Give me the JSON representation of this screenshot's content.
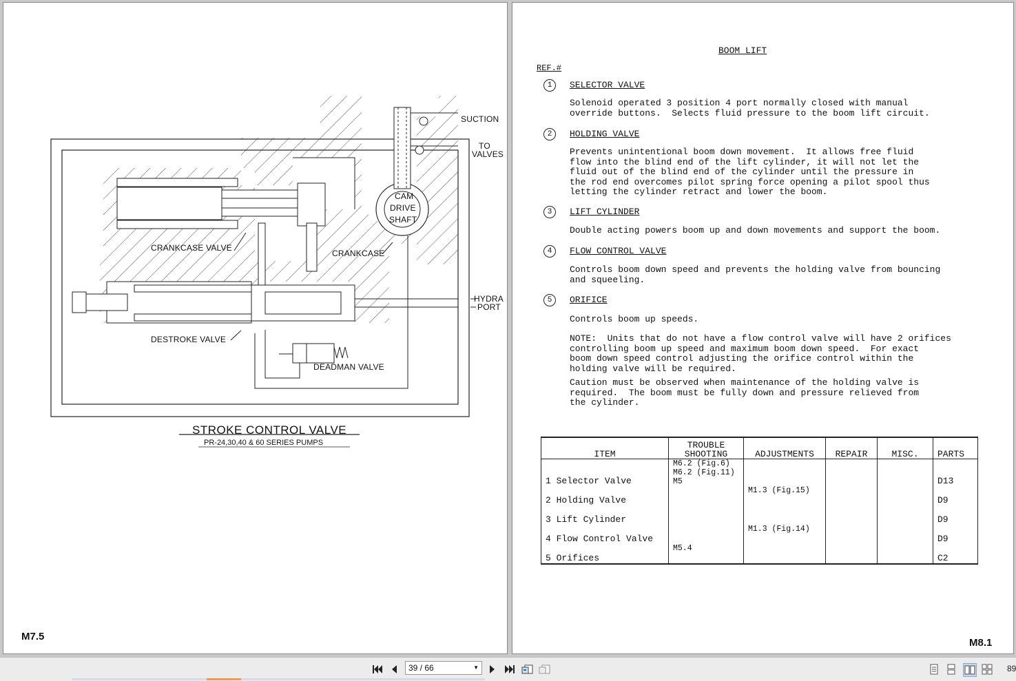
{
  "left_page": {
    "diagram_labels": {
      "suction": "SUCTION",
      "to_valves_1": "TO",
      "to_valves_2": "VALVES",
      "cam_1": "CAM",
      "cam_2": "DRIVE",
      "cam_3": "SHAFT",
      "crankcase_valve": "CRANKCASE VALVE",
      "crankcase": "CRANKCASE",
      "hydra_1": "HYDRA",
      "hydra_2": "PORT",
      "destroke_valve": "DESTROKE VALVE",
      "deadman_valve": "DEADMAN VALVE"
    },
    "title": "STROKE CONTROL VALVE",
    "subtitle": "PR-24,30,40 & 60 SERIES PUMPS",
    "page_number": "M7.5"
  },
  "right_page": {
    "heading": "BOOM LIFT",
    "ref_label": "REF.#",
    "sections": [
      {
        "num": "1",
        "title": "SELECTOR VALVE",
        "body": "Solenoid operated 3 position 4 port normally closed with manual\noverride buttons.  Selects fluid pressure to the boom lift circuit."
      },
      {
        "num": "2",
        "title": "HOLDING VALVE",
        "body": "Prevents unintentional boom down movement.  It allows free fluid\nflow into the blind end of the lift cylinder, it will not let the\nfluid out of the blind end of the cylinder until the pressure in\nthe rod end overcomes pilot spring force opening a pilot spool thus\nletting the cylinder retract and lower the boom."
      },
      {
        "num": "3",
        "title": "LIFT CYLINDER",
        "body": "Double acting powers boom up and down movements and support the boom."
      },
      {
        "num": "4",
        "title": "FLOW CONTROL VALVE",
        "body": "Controls boom down speed and prevents the holding valve from bouncing\nand squeeling."
      },
      {
        "num": "5",
        "title": "ORIFICE",
        "body": "Controls boom up speeds."
      }
    ],
    "note": "NOTE:  Units that do not have a flow control valve will have 2 orifices\ncontrolling boom up speed and maximum boom down speed.  For exact\nboom down speed control adjusting the orifice control within the\nholding valve will be required.",
    "caution": "Caution must be observed when maintenance of the holding valve is\nrequired.  The boom must be fully down and pressure relieved from\nthe cylinder.",
    "table": {
      "headers": {
        "item": "ITEM",
        "ts1": "TROUBLE",
        "ts2": "SHOOTING",
        "adjustments": "ADJUSTMENTS",
        "repair": "REPAIR",
        "misc": "MISC.",
        "parts": "PARTS"
      },
      "rows": [
        {
          "item": "1 Selector Valve",
          "ts": "M6.2 (Fig.6)\nM6.2 (Fig.11)\nM5",
          "adj": "",
          "repair": "",
          "misc": "",
          "parts": "D13"
        },
        {
          "item": "2 Holding Valve",
          "ts": "",
          "adj": "M1.3 (Fig.15)",
          "repair": "",
          "misc": "",
          "parts": "D9"
        },
        {
          "item": "3 Lift Cylinder",
          "ts": "",
          "adj": "",
          "repair": "",
          "misc": "",
          "parts": "D9"
        },
        {
          "item": "4 Flow Control Valve",
          "ts": "",
          "adj": "M1.3 (Fig.14)",
          "repair": "",
          "misc": "",
          "parts": "D9"
        },
        {
          "item": "5 Orifices",
          "ts": "M5.4",
          "adj": "",
          "repair": "",
          "misc": "",
          "parts": "C2"
        }
      ]
    },
    "page_number": "M8.1"
  },
  "toolbar": {
    "page_indicator": "39 / 66",
    "zoom": "89"
  }
}
